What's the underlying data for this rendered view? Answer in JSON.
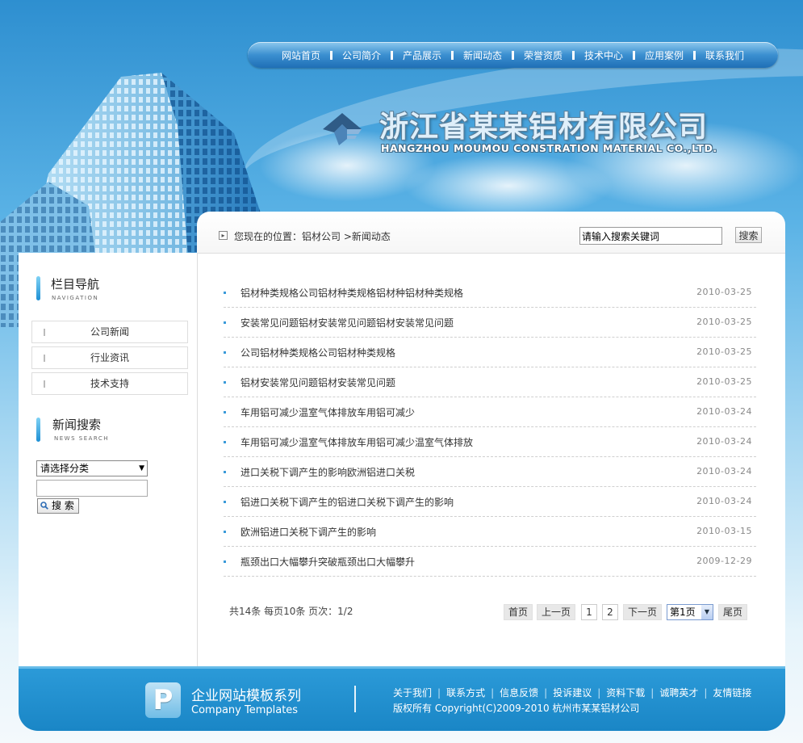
{
  "nav": {
    "items": [
      "网站首页",
      "公司简介",
      "产品展示",
      "新闻动态",
      "荣誉资质",
      "技术中心",
      "应用案例",
      "联系我们"
    ]
  },
  "logo": {
    "cn": "浙江省某某铝材有限公司",
    "en": "HANGZHOU MOUMOU CONSTRATION MATERIAL CO.,LTD."
  },
  "breadcrumb": {
    "prefix": "您现在的位置：",
    "home": "铝材公司",
    "separator": ">",
    "current": "新闻动态"
  },
  "top_search": {
    "value": "请输入搜索关键词",
    "button": "搜索"
  },
  "sidebar": {
    "nav_title": "栏目导航",
    "nav_title_en": "NAVIGATION",
    "items": [
      "公司新闻",
      "行业资讯",
      "技术支持"
    ],
    "search_title": "新闻搜索",
    "search_title_en": "NEWS SEARCH",
    "select_value": "请选择分类",
    "search_button": "搜 索"
  },
  "news": [
    {
      "title": "铝材种类规格公司铝材种类规格铝材种铝材种类规格",
      "date": "2010-03-25"
    },
    {
      "title": "安装常见问题铝材安装常见问题铝材安装常见问题",
      "date": "2010-03-25"
    },
    {
      "title": "公司铝材种类规格公司铝材种类规格",
      "date": "2010-03-25"
    },
    {
      "title": "铝材安装常见问题铝材安装常见问题",
      "date": "2010-03-25"
    },
    {
      "title": "车用铝可减少温室气体排放车用铝可减少",
      "date": "2010-03-24"
    },
    {
      "title": "车用铝可减少温室气体排放车用铝可减少温室气体排放",
      "date": "2010-03-24"
    },
    {
      "title": "进口关税下调产生的影响欧洲铝进口关税",
      "date": "2010-03-24"
    },
    {
      "title": "铝进口关税下调产生的铝进口关税下调产生的影响",
      "date": "2010-03-24"
    },
    {
      "title": "欧洲铝进口关税下调产生的影响",
      "date": "2010-03-15"
    },
    {
      "title": "瓶颈出口大幅攀升突破瓶颈出口大幅攀升",
      "date": "2009-12-29"
    }
  ],
  "pagination": {
    "info": "共14条  每页10条  页次：1/2",
    "first": "首页",
    "prev": "上一页",
    "pages": [
      "1",
      "2"
    ],
    "next": "下一页",
    "select_value": "第1页",
    "last": "尾页"
  },
  "footer": {
    "logo_letter": "P",
    "title_cn": "企业网站模板系列",
    "title_en": "Company Templates",
    "links": [
      "关于我们",
      "联系方式",
      "信息反馈",
      "投诉建议",
      "资料下载",
      "诚聘英才",
      "友情链接"
    ],
    "copyright": "版权所有  Copyright(C)2009-2010 杭州市某某铝材公司"
  }
}
